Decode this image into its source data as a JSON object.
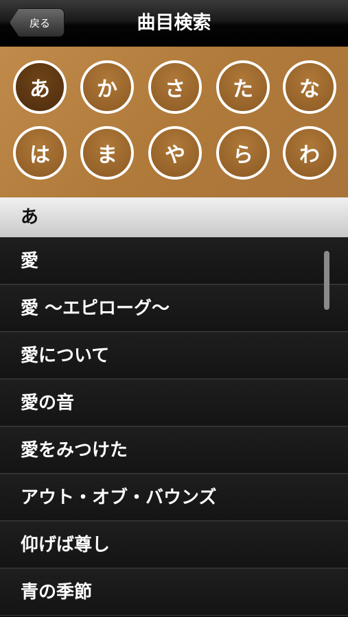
{
  "nav": {
    "back_label": "戻る",
    "title": "曲目検索"
  },
  "kana": [
    "あ",
    "か",
    "さ",
    "た",
    "な",
    "は",
    "ま",
    "や",
    "ら",
    "わ"
  ],
  "selected_kana": "あ",
  "section_header": "あ",
  "songs": [
    "愛",
    "愛 ～エピローグ～",
    "愛について",
    "愛の音",
    "愛をみつけた",
    "アウト・オブ・バウンズ",
    "仰げば尊し",
    "青の季節"
  ]
}
